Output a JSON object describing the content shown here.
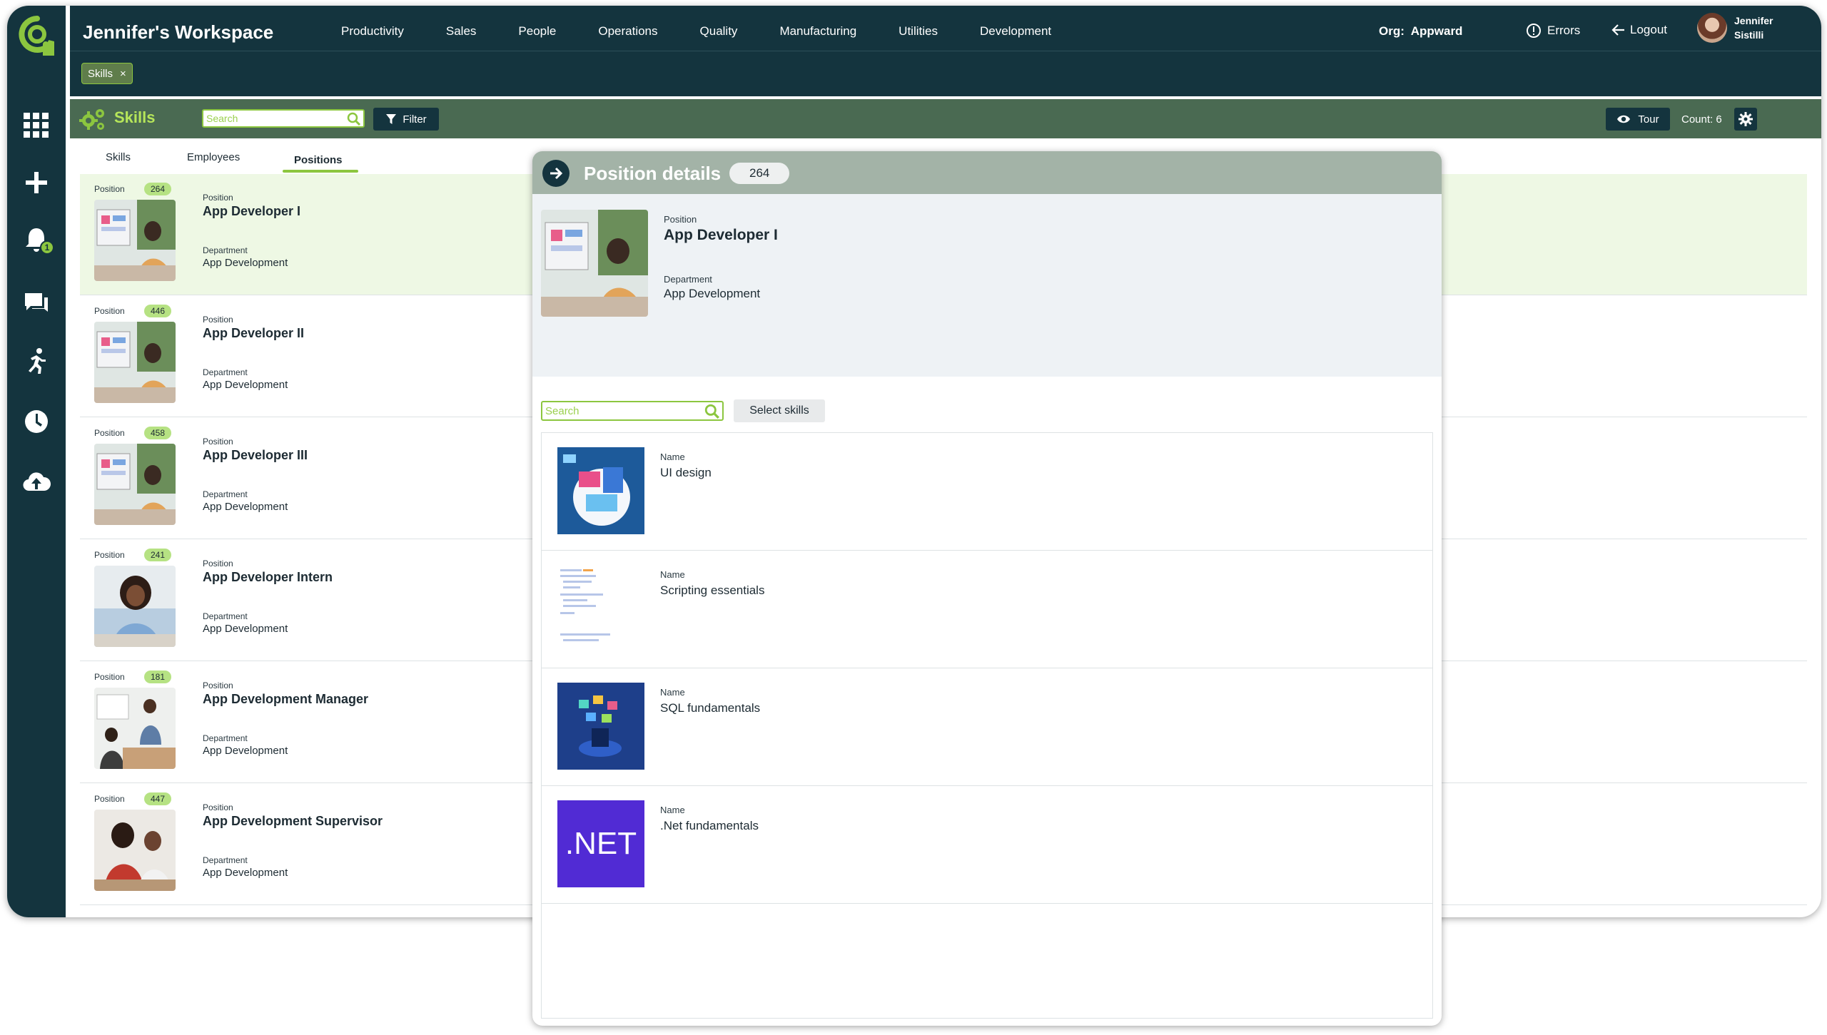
{
  "workspace_title": "Jennifer's Workspace",
  "nav": [
    "Productivity",
    "Sales",
    "People",
    "Operations",
    "Quality",
    "Manufacturing",
    "Utilities",
    "Development"
  ],
  "org": {
    "label": "Org:",
    "value": "Appward"
  },
  "errors_label": "Errors",
  "logout_label": "Logout",
  "user": {
    "first": "Jennifer",
    "last": "Sistilli"
  },
  "chip": {
    "label": "Skills",
    "close": "×"
  },
  "notification_count": "1",
  "toolbar": {
    "title": "Skills",
    "search_placeholder": "Search",
    "filter_label": "Filter",
    "tour_label": "Tour",
    "count_label": "Count: 6"
  },
  "tabs": [
    {
      "label": "Skills"
    },
    {
      "label": "Employees"
    },
    {
      "label": "Positions",
      "active": true
    }
  ],
  "list_labels": {
    "position": "Position",
    "department": "Department"
  },
  "positions": [
    {
      "id": "264",
      "title": "App Developer I",
      "department": "App Development",
      "selected": true
    },
    {
      "id": "446",
      "title": "App Developer II",
      "department": "App Development"
    },
    {
      "id": "458",
      "title": "App Developer III",
      "department": "App Development"
    },
    {
      "id": "241",
      "title": "App Developer Intern",
      "department": "App Development"
    },
    {
      "id": "181",
      "title": "App Development Manager",
      "department": "App Development"
    },
    {
      "id": "447",
      "title": "App Development Supervisor",
      "department": "App Development"
    }
  ],
  "detail": {
    "title": "Position details",
    "badge": "264",
    "position_label": "Position",
    "position": "App Developer I",
    "department_label": "Department",
    "department": "App Development",
    "search_placeholder": "Search",
    "select_skills_label": "Select skills",
    "name_label": "Name",
    "skills": [
      "UI design",
      "Scripting essentials",
      "SQL fundamentals",
      ".Net fundamentals"
    ],
    "net_logo_text": ".NET"
  },
  "colors": {
    "navy": "#14343e",
    "green": "#8cc63f",
    "toolbar": "#4a6a52",
    "selected_row": "#eef8e4"
  }
}
